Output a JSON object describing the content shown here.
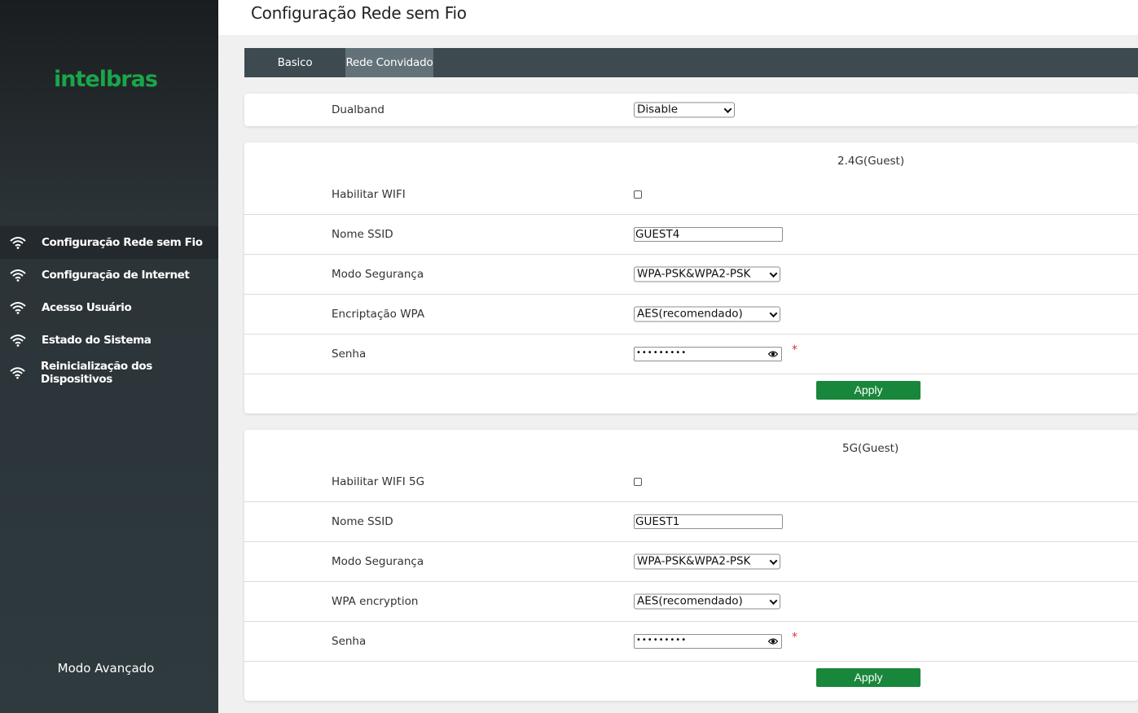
{
  "brand": {
    "logo": "intelbras",
    "color": "#1aa54a"
  },
  "sidebar": {
    "items": [
      {
        "label": "Configuração Rede sem Fio",
        "icon": "wifi-icon",
        "active": true
      },
      {
        "label": "Configuração de Internet",
        "icon": "wifi-icon"
      },
      {
        "label": "Acesso Usuário",
        "icon": "wifi-icon"
      },
      {
        "label": "Estado do Sistema",
        "icon": "wifi-icon"
      },
      {
        "label": "Reinicialização dos Dispositivos",
        "icon": "wifi-icon"
      }
    ],
    "mode_label": "Modo Avançado"
  },
  "header": {
    "title": "Configuração Rede sem Fio"
  },
  "tabs": [
    {
      "label": "Basico"
    },
    {
      "label": "Rede Convidado",
      "active": true
    }
  ],
  "dualband": {
    "label": "Dualband",
    "value": "Disable"
  },
  "guest24": {
    "title": "2.4G(Guest)",
    "enable_label": "Habilitar WIFI",
    "enabled": false,
    "ssid_label": "Nome SSID",
    "ssid_value": "GUEST4",
    "security_label": "Modo Segurança",
    "security_value": "WPA-PSK&WPA2-PSK",
    "encryption_label": "Encriptação WPA",
    "encryption_value": "AES(recomendado)",
    "password_label": "Senha",
    "password_mask": "•••••••••",
    "required_mark": "*",
    "apply_label": "Apply"
  },
  "guest5": {
    "title": "5G(Guest)",
    "enable_label": "Habilitar WIFI 5G",
    "enabled": false,
    "ssid_label": "Nome SSID",
    "ssid_value": "GUEST1",
    "security_label": "Modo Segurança",
    "security_value": "WPA-PSK&WPA2-PSK",
    "encryption_label": "WPA encryption",
    "encryption_value": "AES(recomendado)",
    "password_label": "Senha",
    "password_mask": "•••••••••",
    "required_mark": "*",
    "apply_label": "Apply"
  },
  "colors": {
    "sidebar_bg": "#2e3a3e",
    "tab_bar": "#3d4a50",
    "tab_active": "#627278",
    "apply": "#18873b",
    "required": "#e03030"
  }
}
